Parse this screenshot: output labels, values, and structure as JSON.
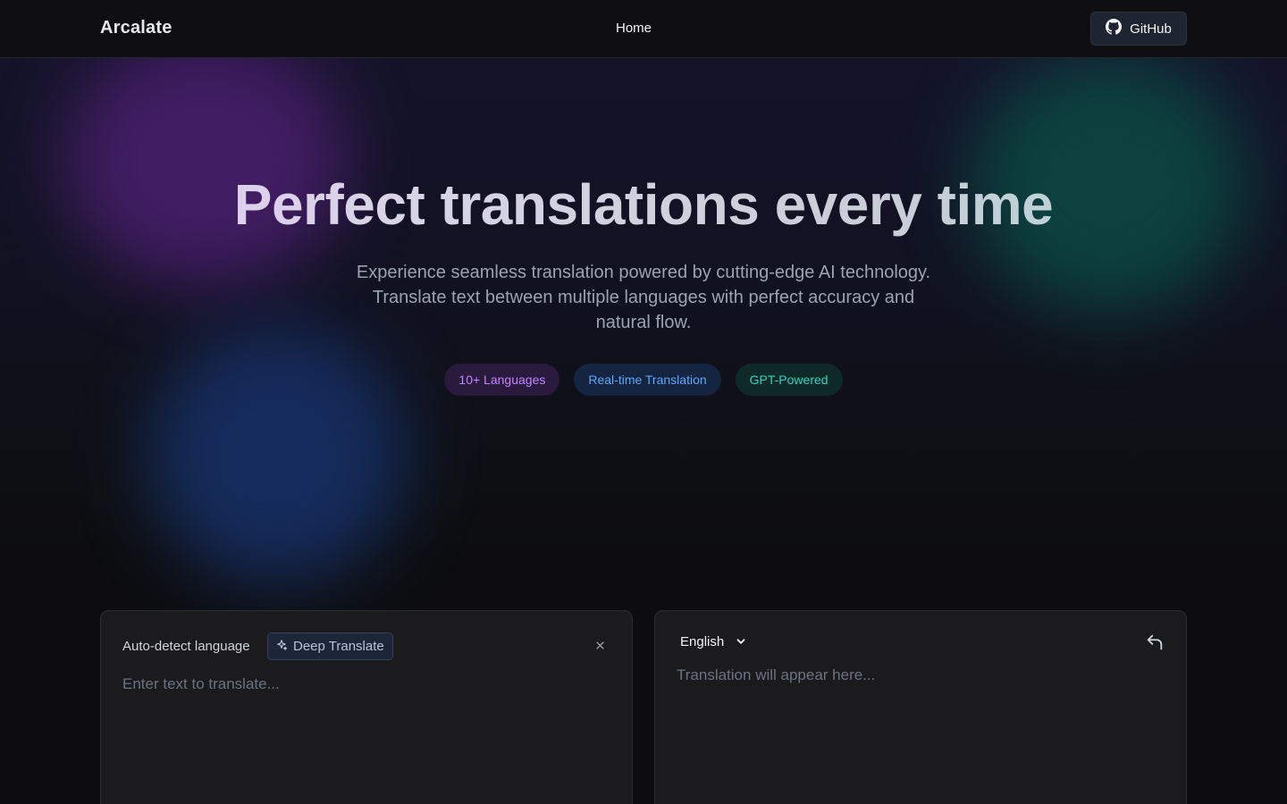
{
  "header": {
    "brand": "Arcalate",
    "nav_home": "Home",
    "github_label": "GitHub",
    "github_icon": "github-icon"
  },
  "hero": {
    "title": "Perfect translations every time",
    "subtitle": "Experience seamless translation powered by cutting-edge AI technology. Translate text between multiple languages with perfect accuracy and natural flow.",
    "badges": [
      {
        "label": "10+ Languages",
        "color": "#c084fc"
      },
      {
        "label": "Real-time Translation",
        "color": "#60a5fa"
      },
      {
        "label": "GPT-Powered",
        "color": "#2dd4bf"
      }
    ]
  },
  "source_panel": {
    "language_label": "Auto-detect language",
    "deep_translate_label": "Deep Translate",
    "deep_translate_icon": "sparkles-icon",
    "clear_icon": "close-icon",
    "input_placeholder": "Enter text to translate...",
    "input_value": ""
  },
  "target_panel": {
    "selected_language": "English",
    "dropdown_icon": "chevron-down-icon",
    "swap_icon": "undo-arrow-icon",
    "output_placeholder": "Translation will appear here..."
  },
  "colors": {
    "background": "#0d0d0f",
    "panel": "#1b1b1d",
    "glow_purple": "#4a1f6e",
    "glow_teal": "#0b4a44",
    "glow_blue": "#17336e"
  }
}
